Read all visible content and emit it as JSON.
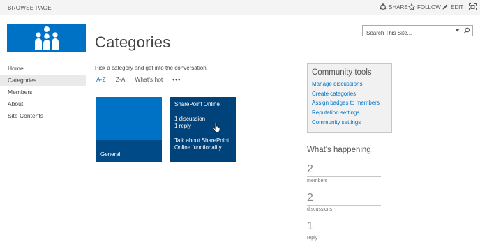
{
  "ribbon": {
    "tabs": [
      "BROWSE",
      "PAGE"
    ],
    "actions": {
      "share": "SHARE",
      "follow": "FOLLOW",
      "edit": "EDIT"
    }
  },
  "logo": {
    "icon": "community-people-icon",
    "color": "#0072c6"
  },
  "page": {
    "title": "Categories"
  },
  "search": {
    "placeholder": "Search This Site..."
  },
  "leftnav": {
    "items": [
      "Home",
      "Categories",
      "Members",
      "About",
      "Site Contents"
    ],
    "active": "Categories"
  },
  "main": {
    "intro": "Pick a category and get into the conversation.",
    "sort": {
      "az": "A-Z",
      "za": "Z-A",
      "hot": "What's hot",
      "more": "•••"
    },
    "tiles": [
      {
        "name": "General",
        "color": "#0072c6"
      },
      {
        "name": "SharePoint Online",
        "discussions": "1 discussion",
        "replies": "1 reply",
        "description": "Talk about SharePoint Online functionality",
        "color": "#00427a"
      }
    ]
  },
  "community_tools": {
    "title": "Community tools",
    "links": [
      "Manage discussions",
      "Create categories",
      "Assign badges to members",
      "Reputation settings",
      "Community settings"
    ]
  },
  "whats_happening": {
    "title": "What's happening",
    "stats": [
      {
        "value": "2",
        "label": "members"
      },
      {
        "value": "2",
        "label": "discussions"
      },
      {
        "value": "1",
        "label": "reply"
      }
    ]
  }
}
